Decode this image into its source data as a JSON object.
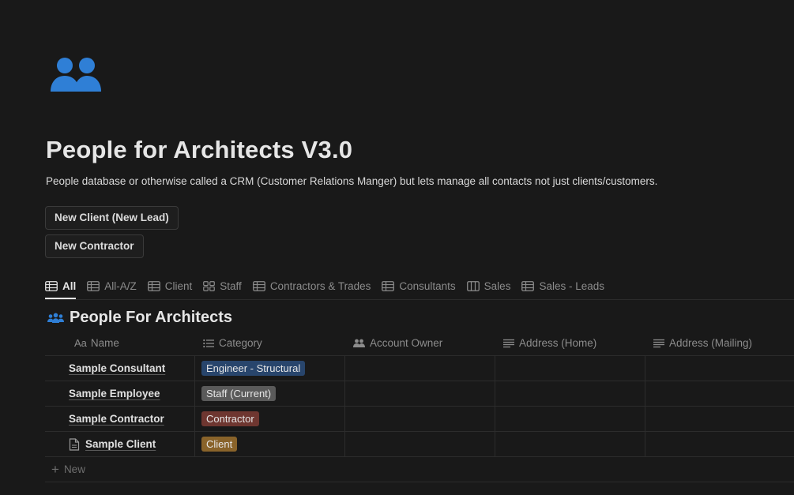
{
  "page": {
    "icon": "people-icon",
    "title": "People for Architects V3.0",
    "description": "People database or otherwise called a CRM (Customer Relations Manger) but lets manage all contacts not just clients/customers."
  },
  "buttons": {
    "new_client": "New Client (New Lead)",
    "new_contractor": "New Contractor"
  },
  "tabs": [
    {
      "label": "All",
      "icon": "table-icon",
      "active": true
    },
    {
      "label": "All-A/Z",
      "icon": "table-icon"
    },
    {
      "label": "Client",
      "icon": "table-icon"
    },
    {
      "label": "Staff",
      "icon": "gallery-icon"
    },
    {
      "label": "Contractors & Trades",
      "icon": "table-icon"
    },
    {
      "label": "Consultants",
      "icon": "table-icon"
    },
    {
      "label": "Sales",
      "icon": "board-icon"
    },
    {
      "label": "Sales - Leads",
      "icon": "table-icon"
    }
  ],
  "database": {
    "title": "People For Architects",
    "icon": "people-icon",
    "columns": {
      "name_prefix": "Aa",
      "name": "Name",
      "category": "Category",
      "account_owner": "Account Owner",
      "address_home": "Address (Home)",
      "address_mailing": "Address (Mailing)"
    },
    "rows": [
      {
        "name": "Sample Consultant",
        "category": "Engineer - Structural",
        "category_color": "#28456c"
      },
      {
        "name": "Sample Employee",
        "category": "Staff (Current)",
        "category_color": "#5a5a5a"
      },
      {
        "name": "Sample Contractor",
        "category": "Contractor",
        "category_color": "#6e3630"
      },
      {
        "name": "Sample Client",
        "category": "Client",
        "category_color": "#89632a",
        "has_doc_icon": true
      }
    ],
    "new_label": "New"
  }
}
